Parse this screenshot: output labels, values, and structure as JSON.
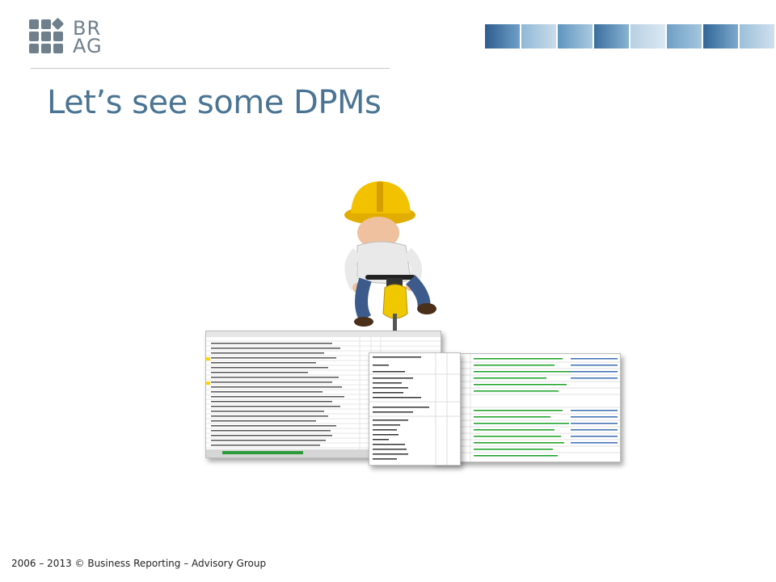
{
  "logo": {
    "line1": "BR",
    "line2": "AG",
    "color": "#6f7f8c"
  },
  "slide": {
    "title": "Let’s see some DPMs",
    "title_color": "#4a7493"
  },
  "illustration": {
    "icon": "construction-worker-jackhammer-icon",
    "helmet_color": "#f2c200"
  },
  "spreadsheets": {
    "icon": "spreadsheet-icon",
    "link_color": "#17a024",
    "highlight_color": "#ffd400"
  },
  "footer": {
    "text": "2006 – 2013 © Business Reporting – Advisory Group"
  }
}
